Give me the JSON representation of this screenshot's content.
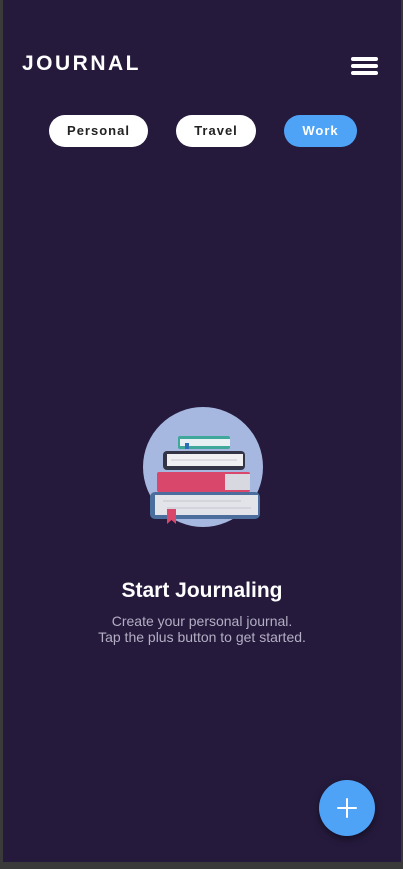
{
  "header": {
    "title": "JOURNAL",
    "menu_icon": "hamburger-menu-icon"
  },
  "tabs": [
    {
      "label": "Personal",
      "active": false
    },
    {
      "label": "Travel",
      "active": false
    },
    {
      "label": "Work",
      "active": true
    }
  ],
  "empty_state": {
    "illustration": "book-stack-illustration",
    "title": "Start Journaling",
    "subtitle_line1": "Create your personal journal.",
    "subtitle_line2": "Tap the plus button to get started."
  },
  "fab": {
    "icon": "plus-icon"
  },
  "colors": {
    "background": "#251a3c",
    "accent": "#4fa3f7",
    "text": "#ffffff",
    "muted_text": "#b3aec4"
  }
}
